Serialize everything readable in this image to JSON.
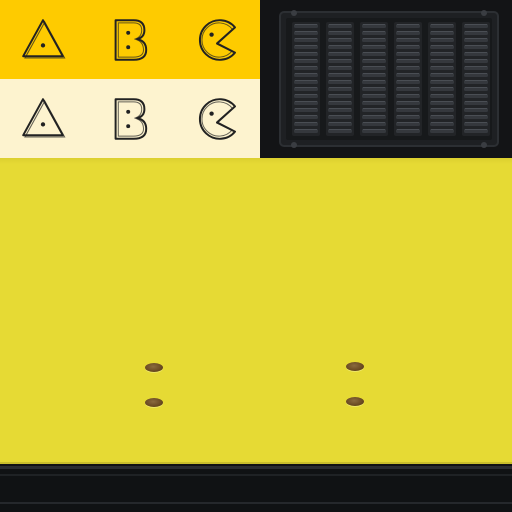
{
  "colors": {
    "icon_row_top_bg": "#fecb00",
    "icon_row_bottom_bg": "#fdf3cf",
    "icon_stroke": "#222222",
    "body_yellow": "#e6da34",
    "vent_dark": "#131416",
    "strip_dark": "#101214"
  },
  "icon_rows": [
    {
      "icons": [
        "triangle-icon",
        "b-shape-icon",
        "pacman-icon"
      ]
    },
    {
      "icons": [
        "triangle-icon",
        "b-shape-icon",
        "pacman-icon"
      ]
    }
  ]
}
